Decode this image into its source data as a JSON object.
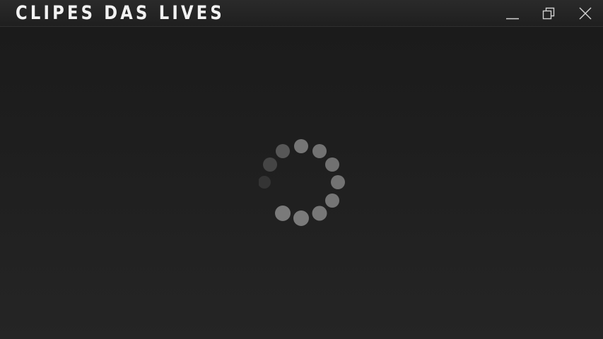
{
  "window": {
    "title": "CLIPES DAS LIVES",
    "controls": {
      "minimize_icon": "minimize-icon",
      "maximize_icon": "restore-icon",
      "close_icon": "close-icon"
    }
  },
  "loading": {
    "indicator": "loading-spinner-icon",
    "dot_color": "#8a8a8a"
  },
  "colors": {
    "background": "#1e1e1e",
    "titlebar": "#242424",
    "title_text": "#f2f2f2",
    "control_icon": "#d0d0d0"
  }
}
